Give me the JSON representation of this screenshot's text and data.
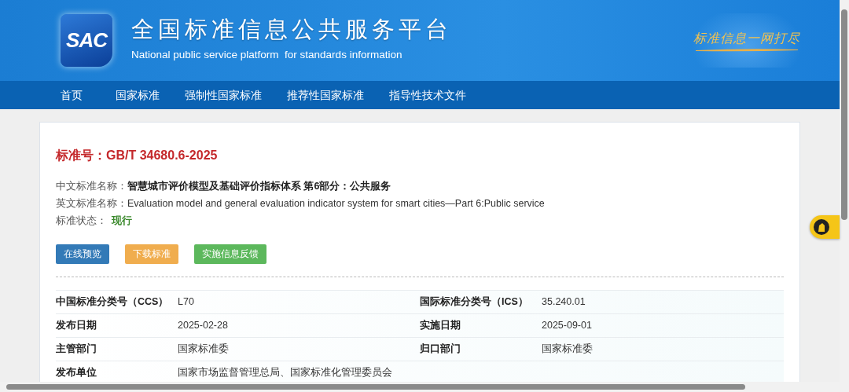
{
  "site": {
    "logo": "SAC",
    "title": "全国标准信息公共服务平台",
    "subtitle": "National public service platform  for standards information",
    "slogan": "标准信息一网打尽"
  },
  "nav": [
    {
      "label": "首页"
    },
    {
      "label": "国家标准"
    },
    {
      "label": "强制性国家标准"
    },
    {
      "label": "推荐性国家标准"
    },
    {
      "label": "指导性技术文件"
    }
  ],
  "standard": {
    "number_label": "标准号：",
    "number": "GB/T 34680.6-2025",
    "fields": [
      {
        "label": "中文标准名称：",
        "value": "智慧城市评价模型及基础评价指标体系 第6部分：公共服务",
        "kind": "bold"
      },
      {
        "label": "英文标准名称：",
        "value": "Evaluation model and general evaluation indicator system for smart cities—Part 6:Public service",
        "kind": "plain"
      },
      {
        "label": "标准状态：",
        "value": "现行",
        "kind": "status"
      }
    ]
  },
  "buttons": [
    {
      "label": "在线预览",
      "kind": "primary"
    },
    {
      "label": "下载标准",
      "kind": "warning"
    },
    {
      "label": "实施信息反馈",
      "kind": "success"
    }
  ],
  "details": [
    [
      {
        "label": "中国标准分类号（CCS）",
        "value": "L70"
      },
      {
        "label": "国际标准分类号（ICS）",
        "value": "35.240.01"
      }
    ],
    [
      {
        "label": "发布日期",
        "value": "2025-02-28"
      },
      {
        "label": "实施日期",
        "value": "2025-09-01"
      }
    ],
    [
      {
        "label": "主管部门",
        "value": "国家标准委"
      },
      {
        "label": "归口部门",
        "value": "国家标准委"
      }
    ],
    [
      {
        "label": "发布单位",
        "value": "国家市场监督管理总局、国家标准化管理委员会"
      }
    ]
  ]
}
